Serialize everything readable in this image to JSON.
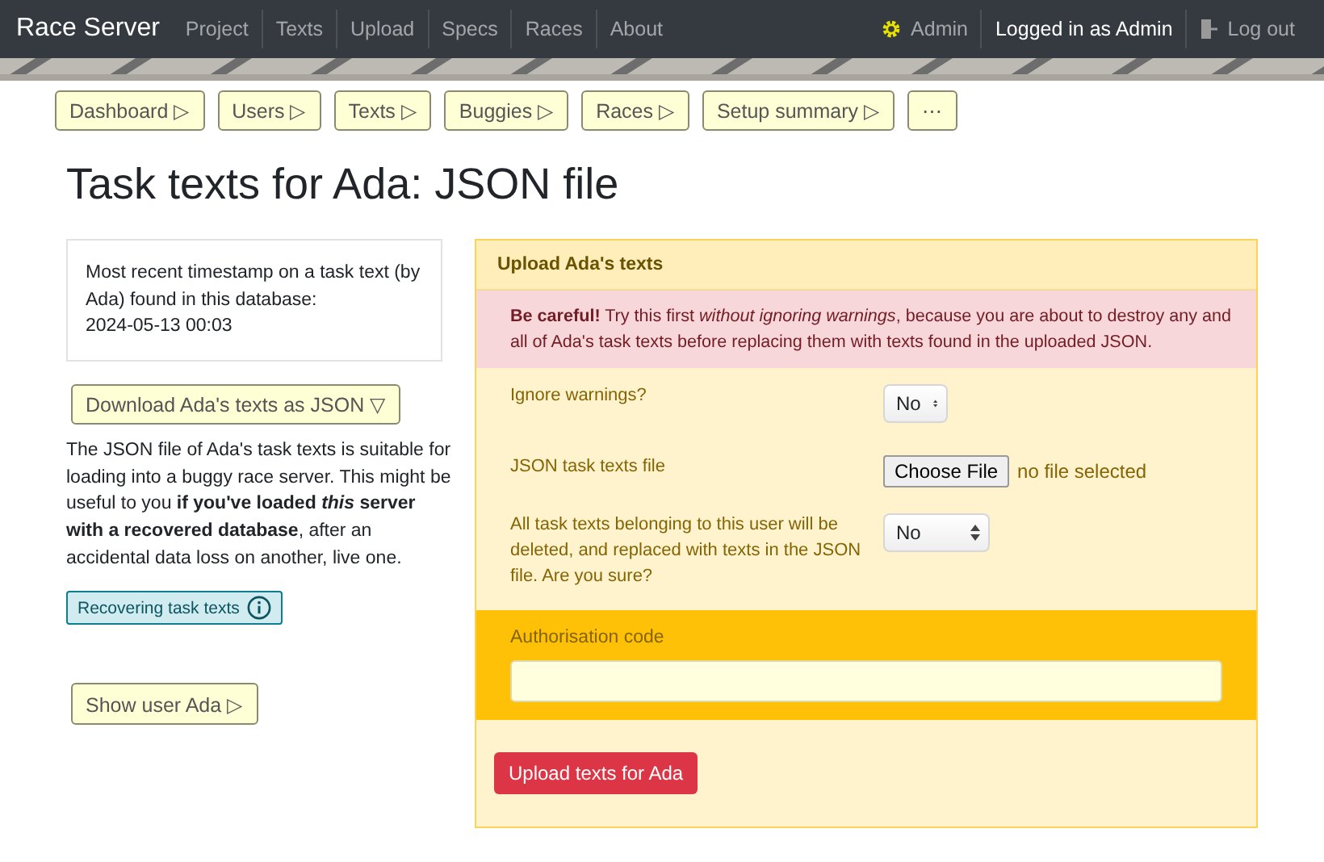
{
  "navbar": {
    "brand": "Race Server",
    "links": [
      "Project",
      "Texts",
      "Upload",
      "Specs",
      "Races",
      "About"
    ],
    "admin_link": "Admin",
    "logged_in": "Logged in as Admin",
    "logout": "Log out"
  },
  "action_buttons": [
    "Dashboard ▷",
    "Users ▷",
    "Texts ▷",
    "Buggies ▷",
    "Races ▷",
    "Setup summary ▷",
    "⋯"
  ],
  "page_title": "Task texts for Ada: JSON file",
  "timestamp_card": {
    "text": "Most recent timestamp on a task text (by Ada) found in this database:",
    "value": "2024-05-13 00:03"
  },
  "download_button": "Download Ada's texts as JSON ▽",
  "description": "The JSON file of Ada's task texts is suitable for loading into a buggy race server. This might be useful to you **if you've loaded *this* server with a recovered database**, after an accidental data loss on another, live one.",
  "help_button": "Recovering task texts",
  "show_user_button": "Show user Ada ▷",
  "upload_panel": {
    "title": "Upload Ada's texts",
    "warning": "**Be careful!** Try this first *without ignoring warnings*, because you are about to destroy any and all of Ada's task texts before replacing them with texts found in the uploaded JSON.",
    "fields": [
      {
        "kind": "select",
        "label": "Ignore warnings?",
        "value": "No"
      },
      {
        "kind": "file",
        "label": "JSON task texts file",
        "button": "Choose File",
        "status": "no file selected"
      },
      {
        "kind": "select",
        "label": "All task texts belonging to this user will be deleted, and replaced with texts in the JSON file. Are you sure?",
        "value": "No"
      }
    ],
    "auth": {
      "label": "Authorisation code"
    },
    "submit": "Upload texts for Ada"
  }
}
